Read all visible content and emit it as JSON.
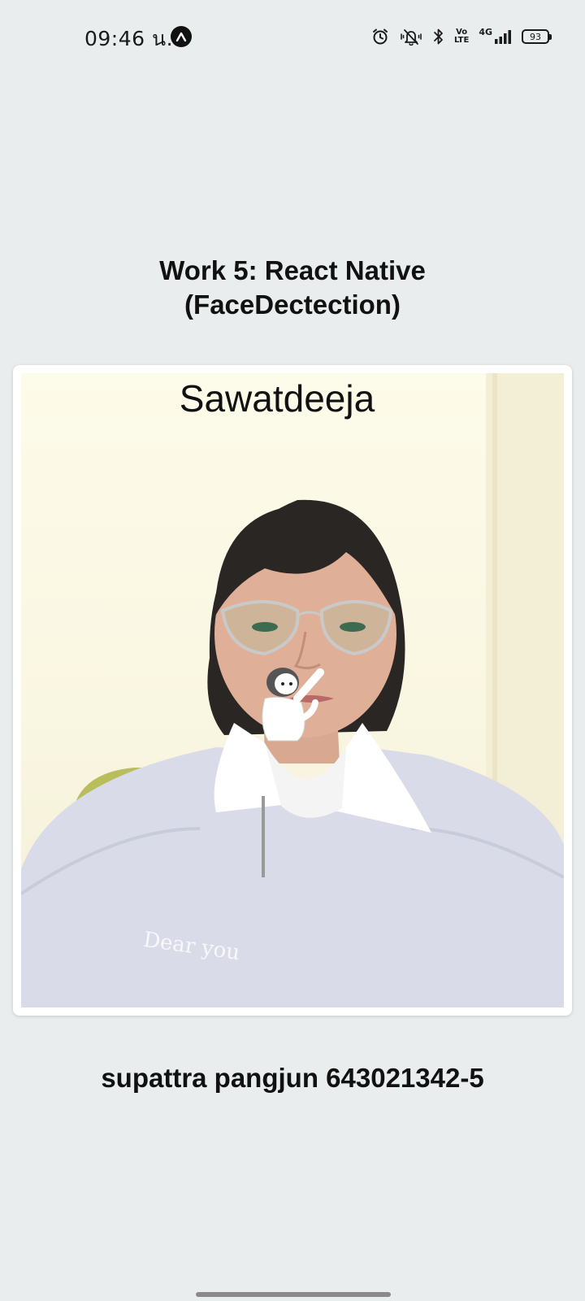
{
  "status_bar": {
    "time": "09:46 น.",
    "network": "4G",
    "battery_level": "93",
    "volte_line1": "Vo",
    "volte_line2": "LTE",
    "icons": [
      "app-notification-icon",
      "alarm-icon",
      "mute-vibrate-icon",
      "bluetooth-icon",
      "volte-icon",
      "signal-icon",
      "battery-icon"
    ]
  },
  "app": {
    "title_line1": "Work 5: React Native",
    "title_line2": "(FaceDectection)"
  },
  "camera": {
    "overlay_text": "Sawatdeeja",
    "shirt_print": "Dear you"
  },
  "footer": {
    "student_info": "supattra pangjun 643021342-5"
  }
}
